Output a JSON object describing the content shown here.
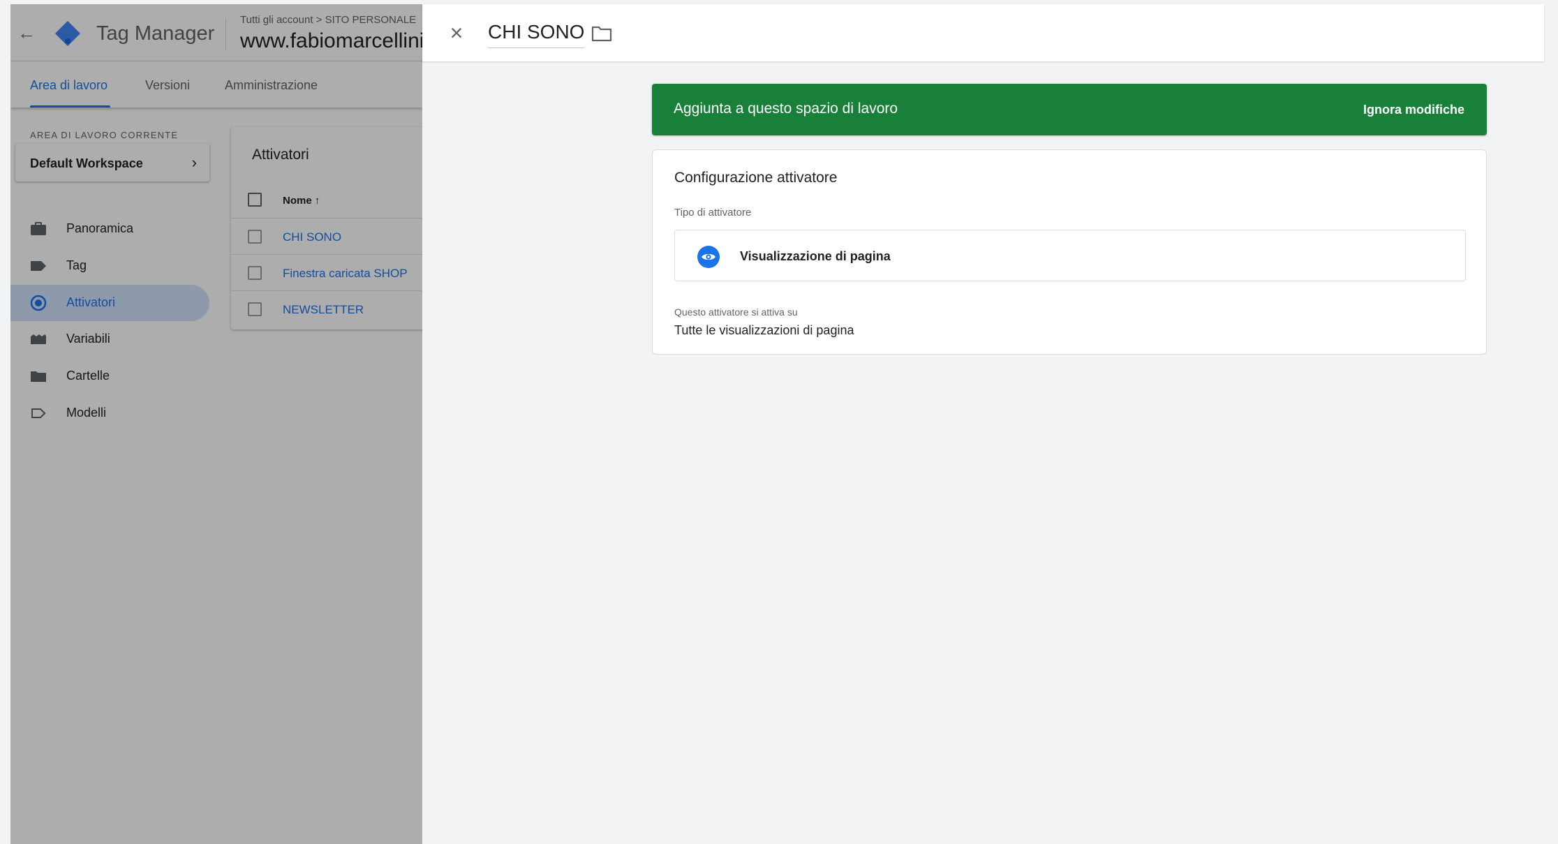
{
  "app": {
    "product_name": "Tag Manager",
    "breadcrumb": "Tutti gli account > SITO PERSONALE",
    "container_name": "www.fabiomarcellini.com",
    "tabs": [
      {
        "label": "Area di lavoro",
        "active": true
      },
      {
        "label": "Versioni",
        "active": false
      },
      {
        "label": "Amministrazione",
        "active": false
      }
    ],
    "workspace": {
      "section_label": "AREA DI LAVORO CORRENTE",
      "name": "Default Workspace"
    },
    "nav": [
      {
        "label": "Panoramica",
        "icon": "briefcase-icon",
        "active": false
      },
      {
        "label": "Tag",
        "icon": "tag-icon",
        "active": false
      },
      {
        "label": "Attivatori",
        "icon": "trigger-icon",
        "active": true
      },
      {
        "label": "Variabili",
        "icon": "variables-icon",
        "active": false
      },
      {
        "label": "Cartelle",
        "icon": "folder-icon",
        "active": false
      },
      {
        "label": "Modelli",
        "icon": "template-icon",
        "active": false
      }
    ],
    "triggers_table": {
      "title": "Attivatori",
      "column_header": "Nome ↑",
      "rows": [
        "CHI SONO",
        "Finestra caricata SHOP",
        "NEWSLETTER"
      ]
    }
  },
  "panel": {
    "title": "CHI SONO",
    "banner": {
      "text": "Aggiunta a questo spazio di lavoro",
      "action": "Ignora modifiche"
    },
    "config": {
      "title": "Configurazione attivatore",
      "type_label": "Tipo di attivatore",
      "type_name": "Visualizzazione di pagina",
      "fires_label": "Questo attivatore si attiva su",
      "fires_value": "Tutte le visualizzazioni di pagina"
    }
  },
  "colors": {
    "accent": "#1a73e8",
    "banner_green": "#188038",
    "active_nav_bg": "#d2e3fc"
  }
}
